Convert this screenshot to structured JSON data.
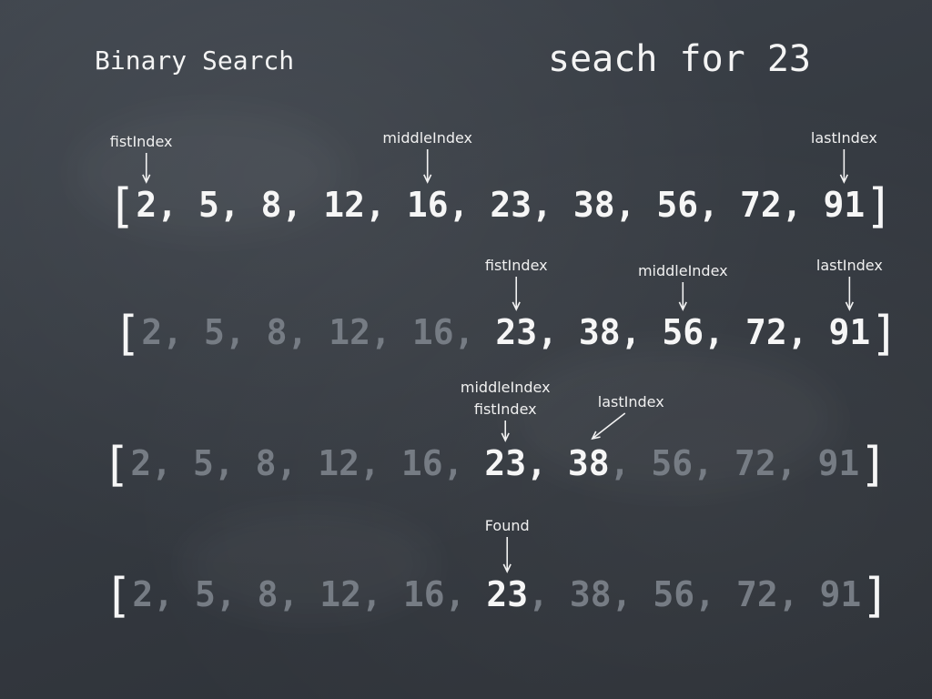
{
  "title": "Binary Search",
  "subtitle": "seach for 23",
  "rows": [
    {
      "elements": [
        {
          "text": "2",
          "active": true
        },
        {
          "text": "5",
          "active": true
        },
        {
          "text": "8",
          "active": true
        },
        {
          "text": "12",
          "active": true
        },
        {
          "text": "16",
          "active": true
        },
        {
          "text": "23",
          "active": true
        },
        {
          "text": "38",
          "active": true
        },
        {
          "text": "56",
          "active": true
        },
        {
          "text": "72",
          "active": true
        },
        {
          "text": "91",
          "active": true
        }
      ],
      "brackets_active": true,
      "labels": [
        {
          "text": "fistIndex",
          "target": 0
        },
        {
          "text": "middleIndex",
          "target": 4
        },
        {
          "text": "lastIndex",
          "target": 9
        }
      ]
    },
    {
      "elements": [
        {
          "text": "2",
          "active": false
        },
        {
          "text": "5",
          "active": false
        },
        {
          "text": "8",
          "active": false
        },
        {
          "text": "12",
          "active": false
        },
        {
          "text": "16",
          "active": false
        },
        {
          "text": "23",
          "active": true
        },
        {
          "text": "38",
          "active": true
        },
        {
          "text": "56",
          "active": true
        },
        {
          "text": "72",
          "active": true
        },
        {
          "text": "91",
          "active": true
        }
      ],
      "brackets_active": true,
      "labels": [
        {
          "text": "fistIndex",
          "target": 5
        },
        {
          "text": "middleIndex",
          "target": 7
        },
        {
          "text": "lastIndex",
          "target": 9
        }
      ]
    },
    {
      "elements": [
        {
          "text": "2",
          "active": false
        },
        {
          "text": "5",
          "active": false
        },
        {
          "text": "8",
          "active": false
        },
        {
          "text": "12",
          "active": false
        },
        {
          "text": "16",
          "active": false
        },
        {
          "text": "23",
          "active": true
        },
        {
          "text": "38",
          "active": true
        },
        {
          "text": "56",
          "active": false
        },
        {
          "text": "72",
          "active": false
        },
        {
          "text": "91",
          "active": false
        }
      ],
      "brackets_active": true,
      "labels": [
        {
          "text": "middleIndex",
          "target": 5
        },
        {
          "text": "fistIndex",
          "target": 5
        },
        {
          "text": "lastIndex",
          "target": 6
        }
      ]
    },
    {
      "elements": [
        {
          "text": "2",
          "active": false
        },
        {
          "text": "5",
          "active": false
        },
        {
          "text": "8",
          "active": false
        },
        {
          "text": "12",
          "active": false
        },
        {
          "text": "16",
          "active": false
        },
        {
          "text": "23",
          "active": true
        },
        {
          "text": "38",
          "active": false
        },
        {
          "text": "56",
          "active": false
        },
        {
          "text": "72",
          "active": false
        },
        {
          "text": "91",
          "active": false
        }
      ],
      "brackets_active": true,
      "labels": [
        {
          "text": "Found",
          "target": 5
        }
      ]
    }
  ],
  "colors": {
    "background": "#363b42",
    "chalk": "#f2f2f2",
    "faded": "#767c84"
  }
}
